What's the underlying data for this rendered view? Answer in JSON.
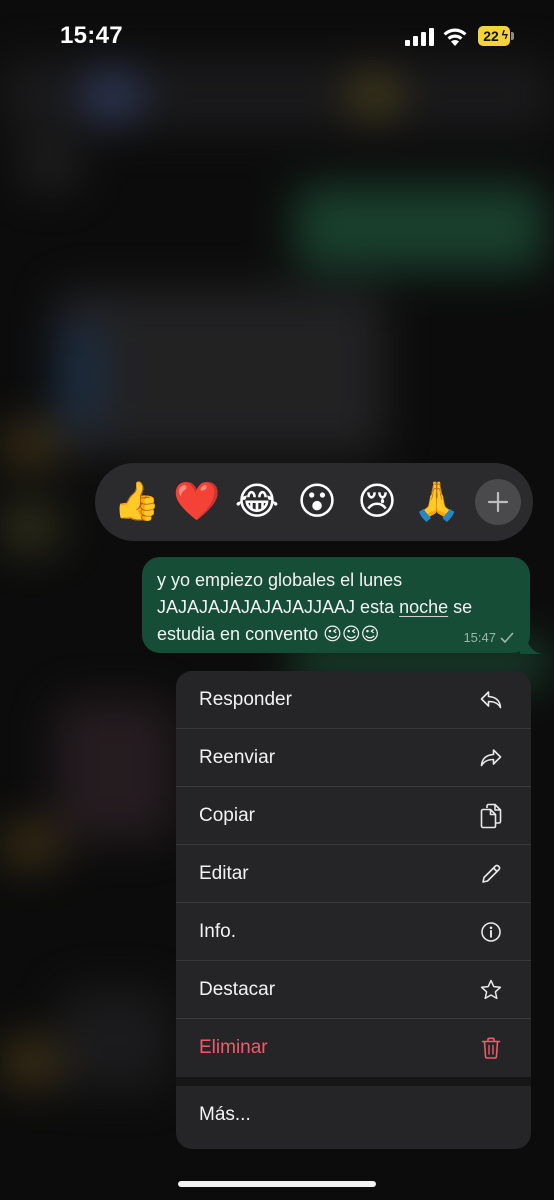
{
  "status_bar": {
    "time": "15:47",
    "battery": "22"
  },
  "reactions": [
    {
      "emoji": "👍",
      "name": "thumbs-up"
    },
    {
      "emoji": "❤️",
      "name": "heart"
    },
    {
      "emoji": "😂",
      "name": "tears-of-joy"
    },
    {
      "emoji": "😮",
      "name": "surprised"
    },
    {
      "emoji": "😢",
      "name": "crying"
    },
    {
      "emoji": "🙏",
      "name": "praying-hands"
    }
  ],
  "message": {
    "line1": "y yo empiezo globales el lunes",
    "line2_pre": "JAJAJAJAJAJAJAJJAAJ esta ",
    "line2_link": "noche",
    "line2_post": " se",
    "line3": "estudia en convento 😉😉😉",
    "time": "15:47",
    "status_icon": "check-icon"
  },
  "menu": {
    "items": [
      {
        "label": "Responder",
        "icon": "reply-icon"
      },
      {
        "label": "Reenviar",
        "icon": "forward-icon"
      },
      {
        "label": "Copiar",
        "icon": "copy-icon"
      },
      {
        "label": "Editar",
        "icon": "pencil-icon"
      },
      {
        "label": "Info.",
        "icon": "info-icon"
      },
      {
        "label": "Destacar",
        "icon": "star-icon"
      },
      {
        "label": "Eliminar",
        "icon": "trash-icon"
      }
    ],
    "more_label": "Más..."
  },
  "colors": {
    "bubble": "#154d36",
    "menu_bg": "#252527",
    "danger": "#ef5b6a",
    "battery": "#f5d33b"
  }
}
